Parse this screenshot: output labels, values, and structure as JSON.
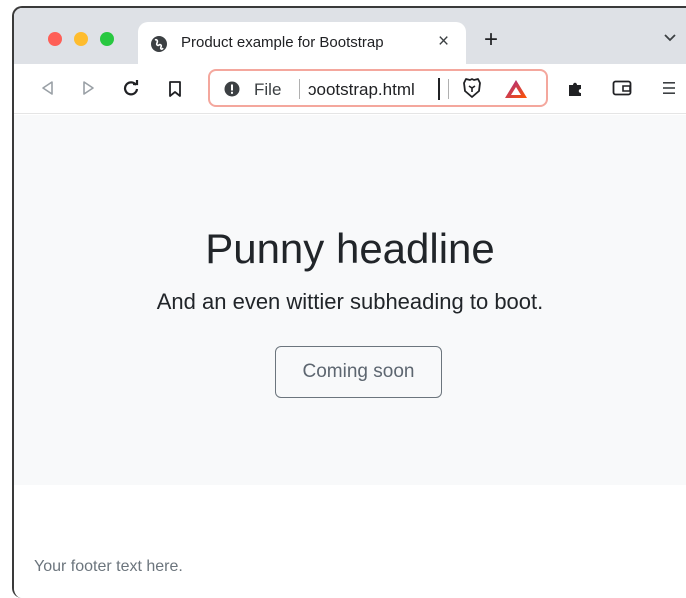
{
  "browser": {
    "tab_title": "Product example for Bootstrap",
    "tab_close": "×",
    "new_tab": "+",
    "address_bar": {
      "scheme_label": "File",
      "url_text": "ɔootstrap.html"
    }
  },
  "page": {
    "headline": "Punny headline",
    "subheading": "And an even wittier subheading to boot.",
    "button_label": "Coming soon",
    "footer_text": "Your footer text here."
  },
  "colors": {
    "tabstrip": "#dee1e6",
    "hero_background": "#f8f9fa",
    "omnibox_border": "#f4a79d",
    "close_red": "#fe5f57",
    "minimize_yellow": "#febc2e",
    "zoom_green": "#28c840"
  },
  "icons": [
    "globe-icon",
    "back-icon",
    "forward-icon",
    "reload-icon",
    "bookmark-icon",
    "info-icon",
    "brave-shield-icon",
    "brave-rewards-icon",
    "extensions-icon",
    "wallet-icon",
    "menu-icon",
    "chevron-down-icon"
  ]
}
